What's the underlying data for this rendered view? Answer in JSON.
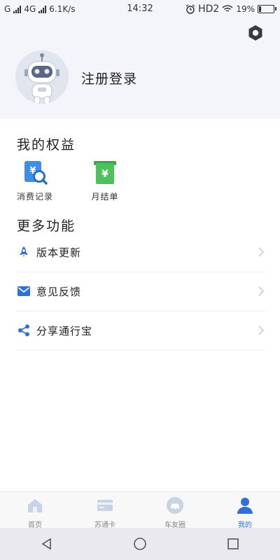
{
  "status_bar": {
    "signal_left": "G",
    "network": "4G",
    "speed": "6.1K/s",
    "time": "14:32",
    "hd": "HD2",
    "battery": "19%",
    "battery_level": 0.19
  },
  "profile": {
    "login_label": "注册登录",
    "avatar": "robot-avatar",
    "settings_icon": "gear-icon"
  },
  "benefits": {
    "title": "我的权益",
    "items": [
      {
        "label": "消费记录",
        "icon": "receipt-search-icon",
        "color": "#3d8ee8"
      },
      {
        "label": "月结单",
        "icon": "yuan-bill-icon",
        "color": "#4cc35a"
      }
    ]
  },
  "more": {
    "title": "更多功能",
    "items": [
      {
        "label": "版本更新",
        "icon": "rocket-icon"
      },
      {
        "label": "意见反馈",
        "icon": "mail-icon"
      },
      {
        "label": "分享通行宝",
        "icon": "share-icon"
      }
    ]
  },
  "tabbar": {
    "tabs": [
      {
        "label": "首页",
        "icon": "home-icon"
      },
      {
        "label": "苏通卡",
        "icon": "card-icon"
      },
      {
        "label": "车友圈",
        "icon": "car-icon"
      },
      {
        "label": "我的",
        "icon": "user-icon",
        "active": true
      }
    ]
  },
  "colors": {
    "accent": "#2f6fd6",
    "header_bg": "#f4f4fb",
    "inactive_icon": "#c7d3e6"
  }
}
